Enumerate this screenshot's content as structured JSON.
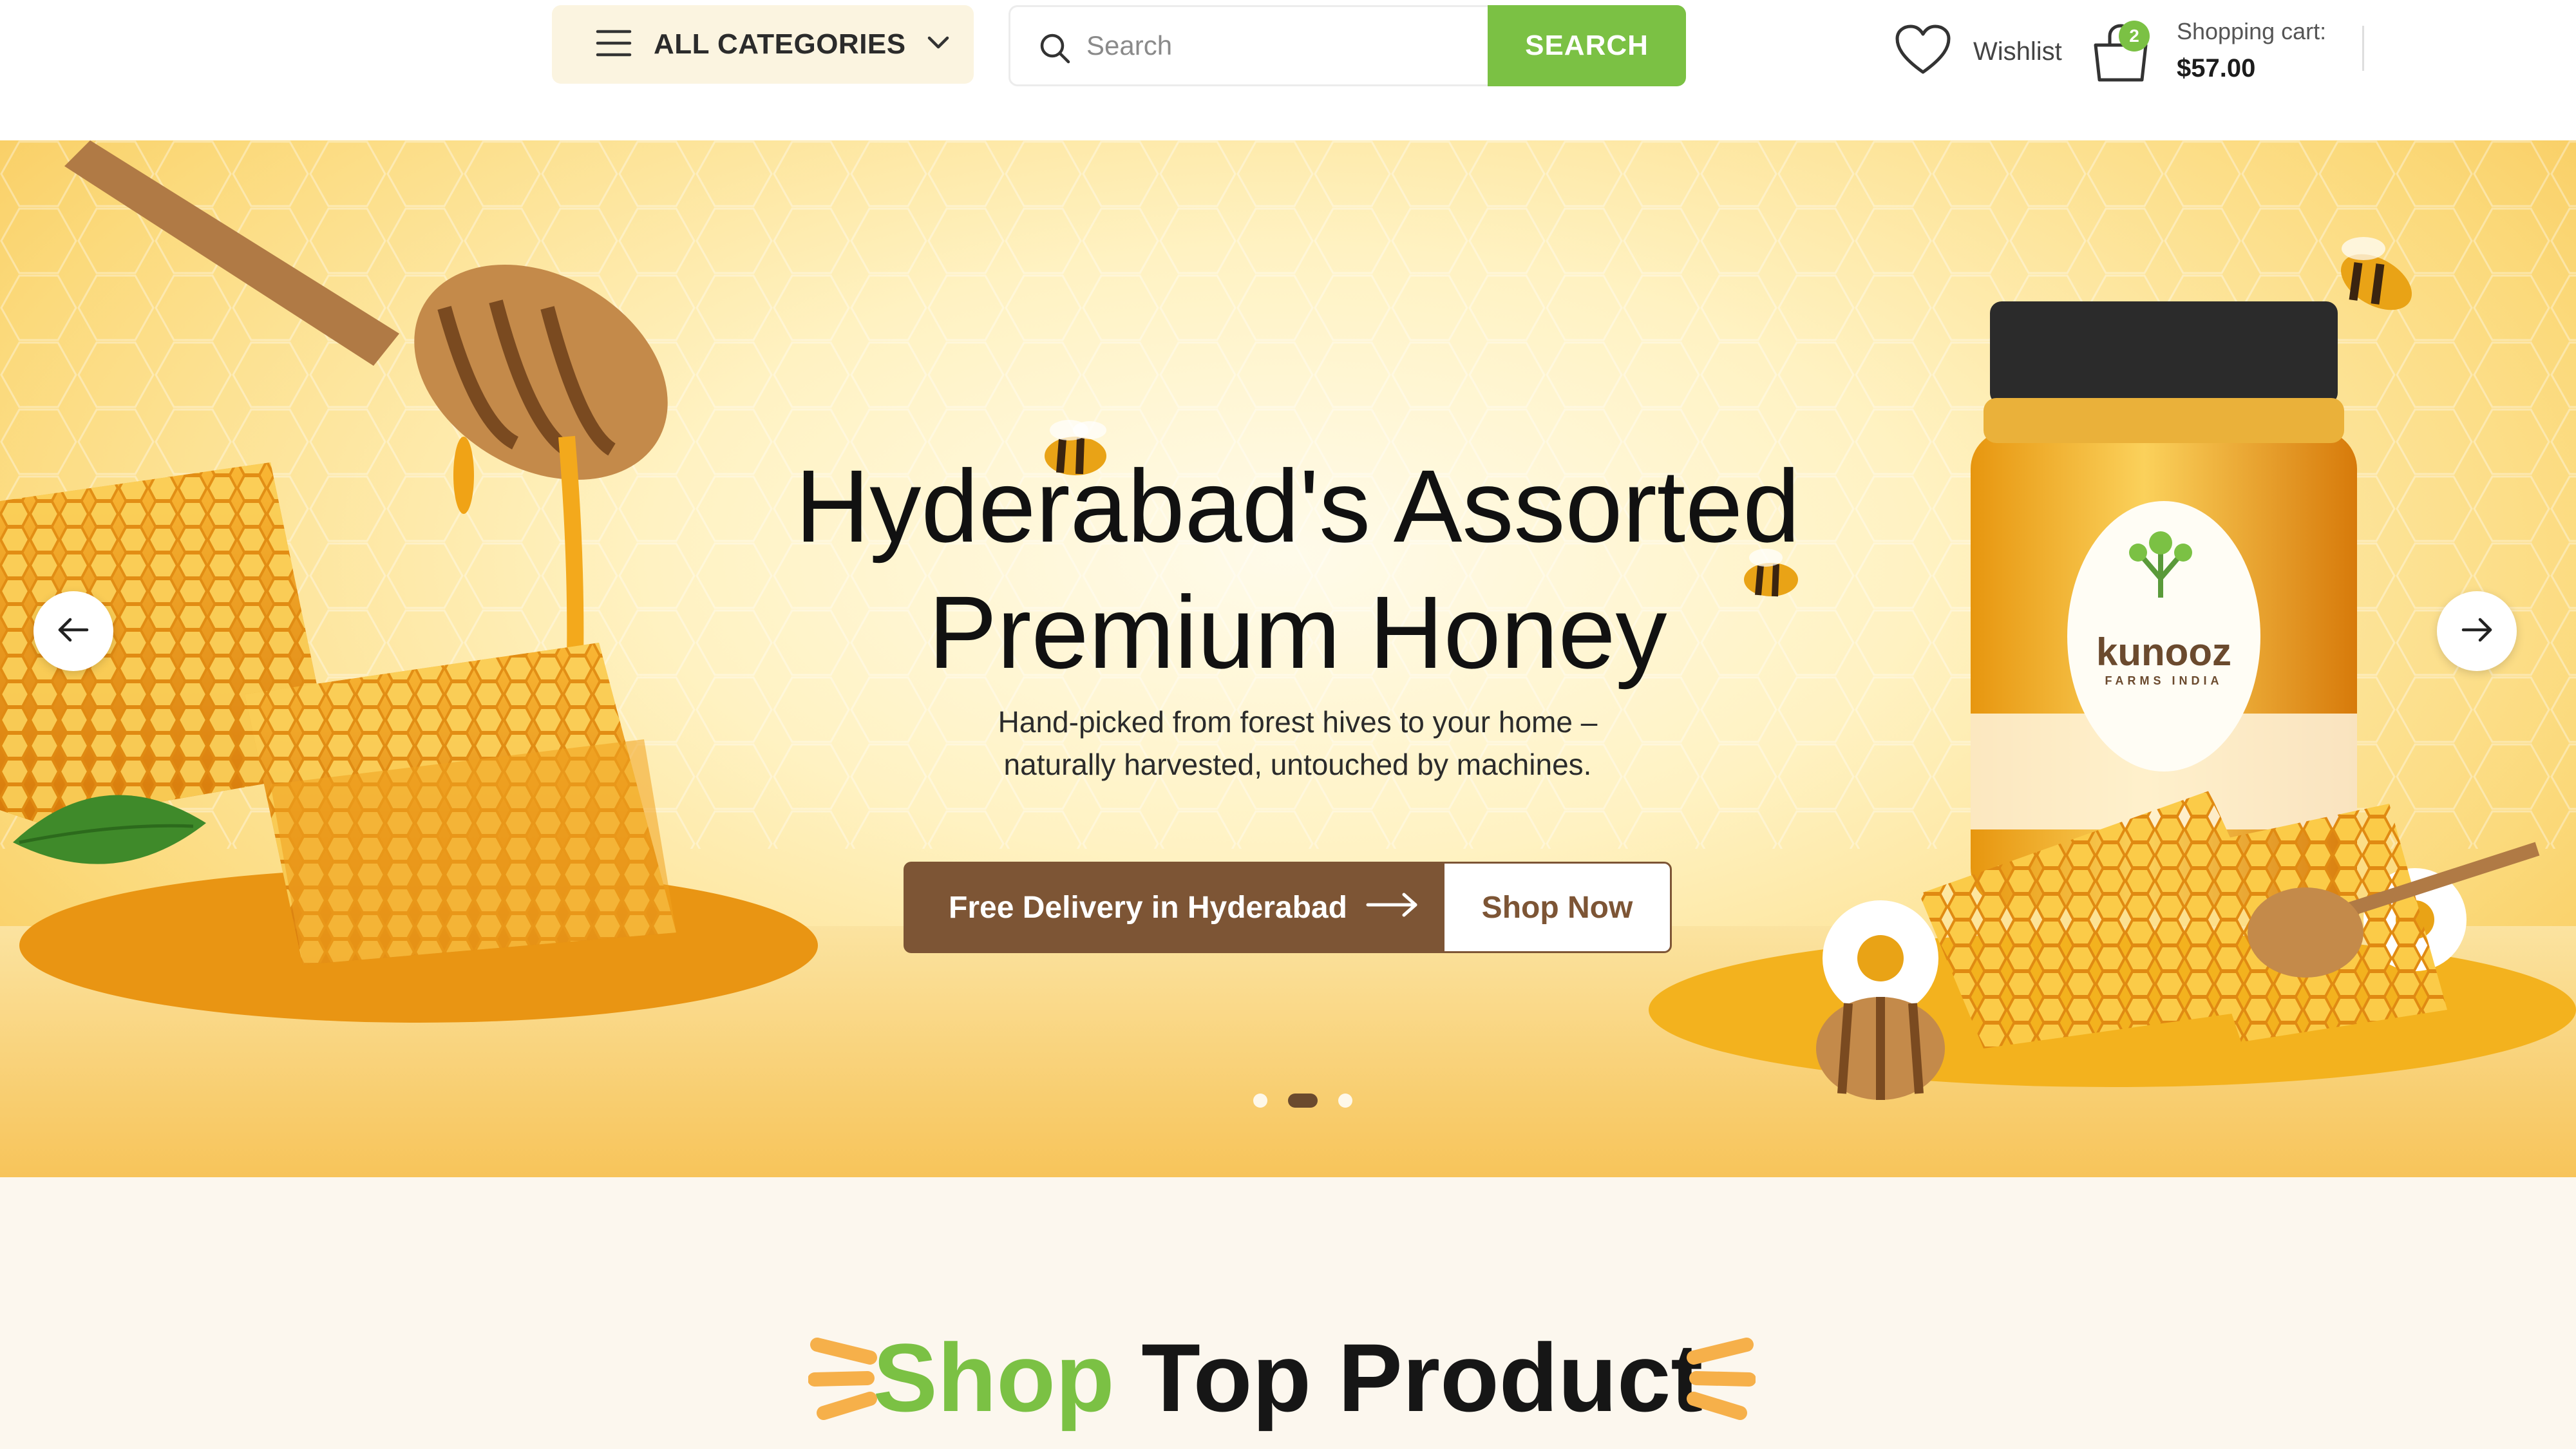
{
  "header": {
    "categories_label": "ALL CATEGORIES",
    "search_placeholder": "Search",
    "search_button": "SEARCH",
    "wishlist_label": "Wishlist",
    "cart_count": "2",
    "cart_label": "Shopping cart:",
    "cart_total": "$57.00"
  },
  "hero": {
    "title_line1": "Hyderabad's Assorted",
    "title_line2": "Premium Honey",
    "subtitle_line1": "Hand-picked from forest hives to your home –",
    "subtitle_line2": "naturally harvested, untouched by machines.",
    "cta_delivery": "Free Delivery in Hyderabad",
    "cta_shop": "Shop Now",
    "brand_name": "kunooz",
    "brand_tagline": "FARMS INDIA",
    "slides_total": 3,
    "active_slide": 2
  },
  "section": {
    "title_highlight": "Shop",
    "title_rest": "Top Product"
  },
  "colors": {
    "accent_green": "#7bc144",
    "brown": "#7d5535",
    "honey": "#f6c24c"
  },
  "icons": [
    "menu-icon",
    "chevron-down-icon",
    "search-icon",
    "heart-icon",
    "shopping-bag-icon",
    "arrow-left-icon",
    "arrow-right-icon"
  ]
}
